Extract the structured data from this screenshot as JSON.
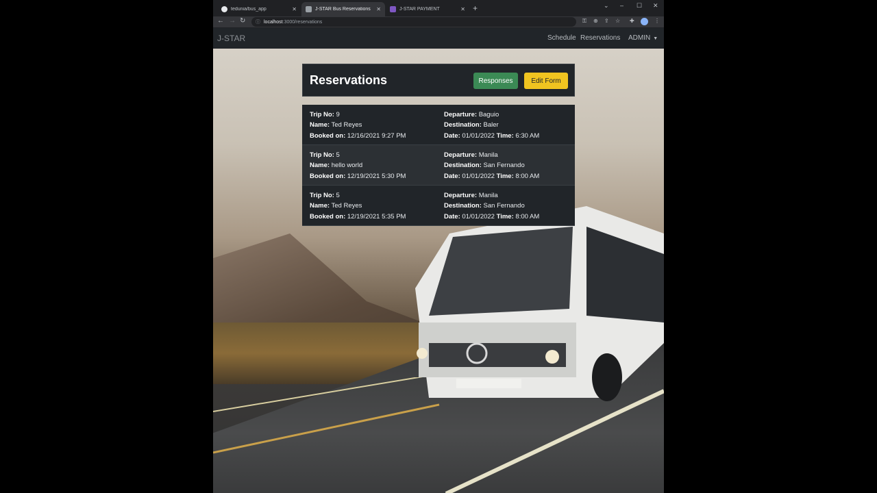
{
  "browser": {
    "tabs": [
      {
        "title": "tedunia/bus_app",
        "active": false
      },
      {
        "title": "J-STAR Bus Reservations",
        "active": true
      },
      {
        "title": "J-STAR PAYMENT",
        "active": false
      }
    ],
    "new_tab": "+",
    "url_host": "localhost",
    "url_rest": ":3000/reservations"
  },
  "navbar": {
    "brand": "J-STAR",
    "links": [
      "Schedule",
      "Reservations",
      "ADMIN"
    ]
  },
  "header": {
    "title": "Reservations",
    "responses_label": "Responses",
    "edit_label": "Edit Form"
  },
  "labels": {
    "trip_no": "Trip No:",
    "name": "Name:",
    "booked_on": "Booked on:",
    "departure": "Departure:",
    "destination": "Destination:",
    "date": "Date:",
    "time": "Time:"
  },
  "reservations": [
    {
      "trip_no": "9",
      "name": "Ted Reyes",
      "booked_on": "12/16/2021 9:27 PM",
      "departure": "Baguio",
      "destination": "Baler",
      "date": "01/01/2022",
      "time": "6:30 AM"
    },
    {
      "trip_no": "5",
      "name": "hello world",
      "booked_on": "12/19/2021 5:30 PM",
      "departure": "Manila",
      "destination": "San Fernando",
      "date": "01/01/2022",
      "time": "8:00 AM"
    },
    {
      "trip_no": "5",
      "name": "Ted Reyes",
      "booked_on": "12/19/2021 5:35 PM",
      "departure": "Manila",
      "destination": "San Fernando",
      "date": "01/01/2022",
      "time": "8:00 AM"
    }
  ]
}
